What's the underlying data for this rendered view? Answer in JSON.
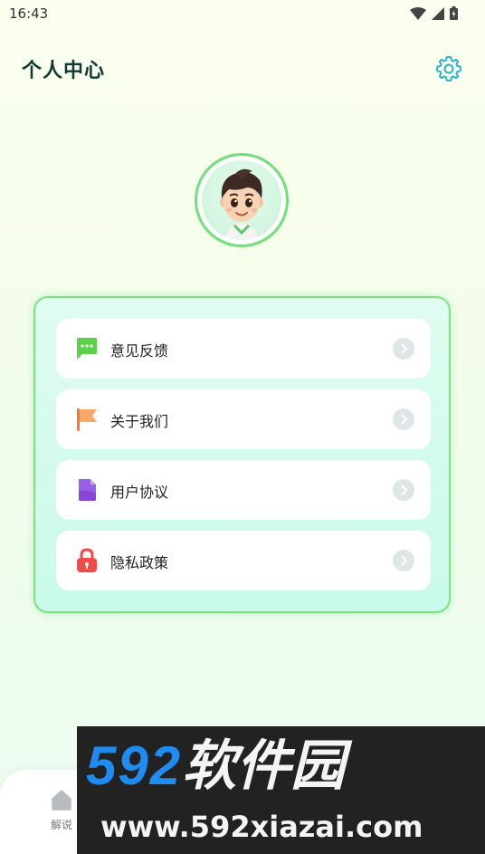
{
  "status_bar": {
    "time": "16:43",
    "icons": [
      "wifi-icon",
      "signal-icon",
      "battery-icon"
    ]
  },
  "header": {
    "title": "个人中心",
    "settings_icon": "gear-icon"
  },
  "profile": {
    "avatar": "avatar-cartoon-boy"
  },
  "menu": {
    "items": [
      {
        "label": "意见反馈",
        "icon": "chat-bubble-icon",
        "color": "#5ccf4b"
      },
      {
        "label": "关于我们",
        "icon": "flag-icon",
        "color": "#f59a4e"
      },
      {
        "label": "用户协议",
        "icon": "document-icon",
        "color": "#9b5ee6"
      },
      {
        "label": "隐私政策",
        "icon": "lock-icon",
        "color": "#f04a4a"
      }
    ]
  },
  "bottom_nav": {
    "items": [
      {
        "label": "解说",
        "icon": "home-icon"
      }
    ]
  },
  "watermark": {
    "number": "592",
    "brand": "软件园",
    "url": "www.592xiazai.com"
  },
  "colors": {
    "accent": "#6fe07a",
    "title": "#0d3b33",
    "settings": "#2bb3c9"
  }
}
